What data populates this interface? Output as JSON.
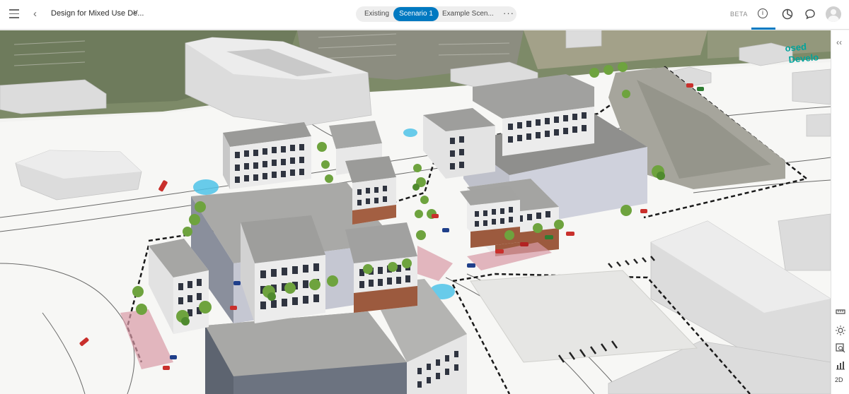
{
  "header": {
    "menu_icon": "hamburger-icon",
    "back_icon": "chevron-left-icon",
    "title": "Design for Mixed Use De...",
    "title_dropdown_icon": "chevron-down-icon",
    "beta_label": "BETA"
  },
  "scenarios": {
    "tabs": [
      {
        "label": "Existing",
        "active": false
      },
      {
        "label": "Scenario 1",
        "active": true
      },
      {
        "label": "Example Scen...",
        "active": false
      }
    ],
    "more_label": "···"
  },
  "toolbar_right": {
    "icons": [
      "info-icon",
      "dashboard-icon",
      "comment-icon",
      "user-avatar-icon"
    ],
    "side": [
      "collapse-panel-icon",
      "measure-icon",
      "daylight-icon",
      "search-layer-icon",
      "chart-icon",
      "view-2d-label"
    ],
    "collapse_label": "‹‹",
    "view_2d_label": "2D"
  },
  "scene": {
    "sign_text_1": "osed",
    "sign_text_2": "Develo"
  },
  "colors": {
    "accent": "#0079c1",
    "dashed_boundary": "#1a1a1a",
    "water": "#4fc3e8"
  }
}
